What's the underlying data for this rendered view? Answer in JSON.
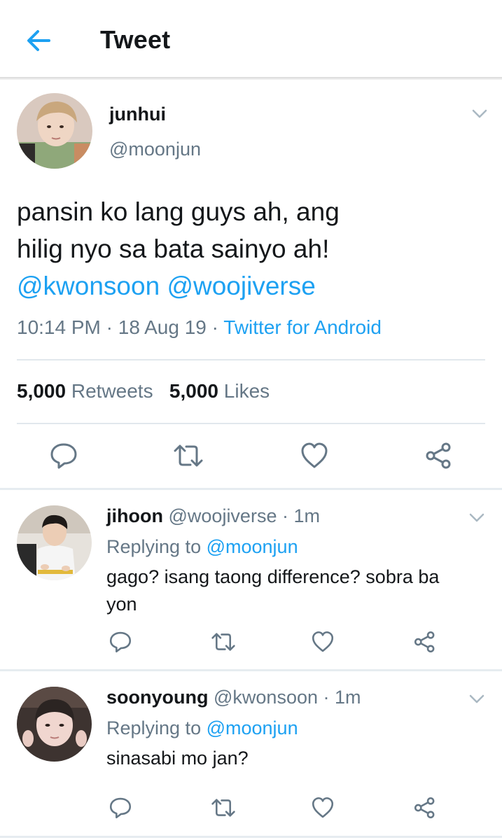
{
  "header": {
    "title": "Tweet"
  },
  "main_tweet": {
    "name": "junhui",
    "handle": "@moonjun",
    "text_line1": "pansin ko lang guys ah, ang",
    "text_line2": "hilig nyo sa bata sainyo ah!",
    "mention1": "@kwonsoon",
    "mention2": "@woojiverse",
    "time": "10:14 PM",
    "date": "18 Aug 19",
    "separator": "·",
    "client": "Twitter for Android",
    "retweets_count": "5,000",
    "retweets_label": "Retweets",
    "likes_count": "5,000",
    "likes_label": "Likes"
  },
  "replies": [
    {
      "name": "jihoon",
      "handle": "@woojiverse",
      "time": "· 1m",
      "replying_label": "Replying to",
      "replying_to": "@moonjun",
      "text_line1": "gago? isang taong difference? sobra ba",
      "text_line2": "yon"
    },
    {
      "name": "soonyoung",
      "handle": "@kwonsoon",
      "time": "· 1m",
      "replying_label": "Replying to",
      "replying_to": "@moonjun",
      "text_line1": "sinasabi mo jan?"
    }
  ],
  "colors": {
    "accent": "#1da1f2",
    "text_primary": "#14171a",
    "text_secondary": "#657786",
    "icon_gray": "#657786",
    "divider": "#e1e8ed"
  },
  "icons": [
    "back-arrow-icon",
    "chevron-down-icon",
    "reply-icon",
    "retweet-icon",
    "like-icon",
    "share-icon"
  ]
}
